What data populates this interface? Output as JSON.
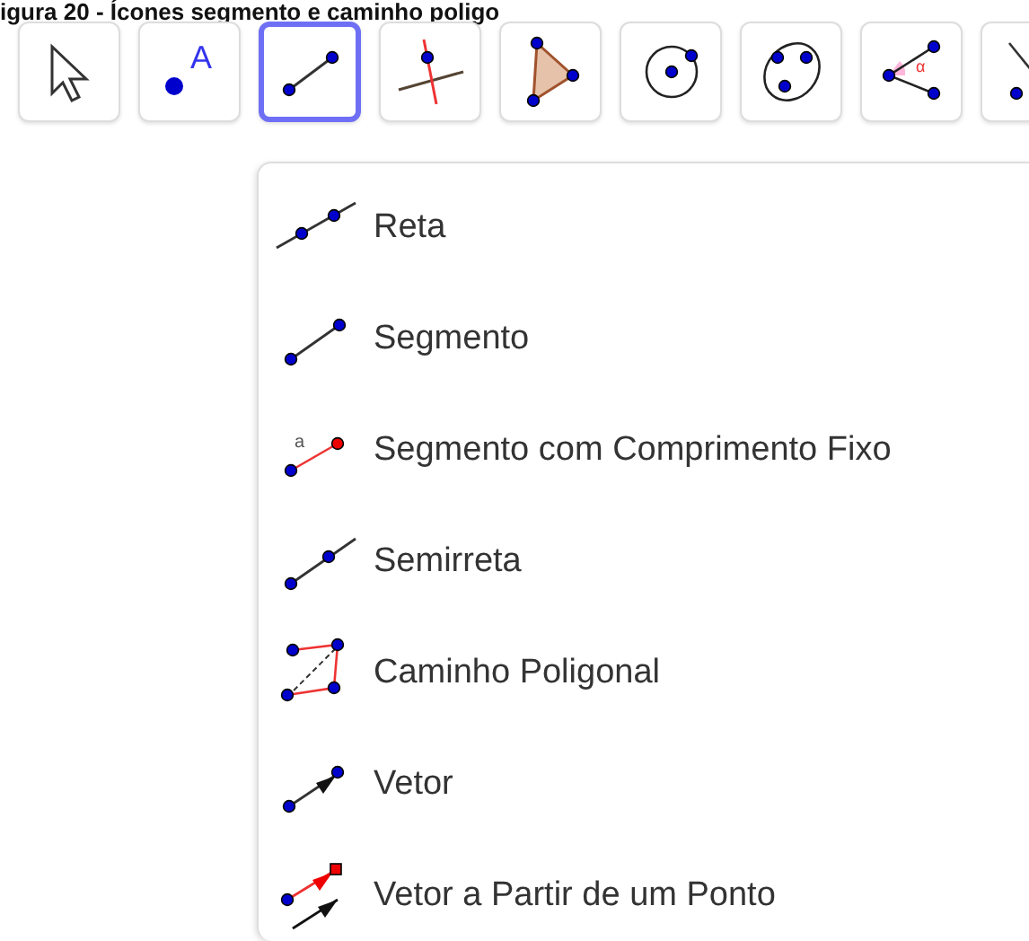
{
  "caption": "igura 20 - Ícones segmento e caminho poligo",
  "toolbar": {
    "tools": [
      {
        "kind": "move",
        "selected": false
      },
      {
        "kind": "point",
        "selected": false,
        "label": "A"
      },
      {
        "kind": "segment",
        "selected": true
      },
      {
        "kind": "perpendicular",
        "selected": false
      },
      {
        "kind": "polygon",
        "selected": false
      },
      {
        "kind": "circle",
        "selected": false
      },
      {
        "kind": "conic",
        "selected": false
      },
      {
        "kind": "angle",
        "selected": false,
        "label": "α"
      },
      {
        "kind": "slope",
        "selected": false
      }
    ]
  },
  "menu": {
    "items": [
      {
        "kind": "line",
        "label": "Reta"
      },
      {
        "kind": "segment",
        "label": "Segmento"
      },
      {
        "kind": "fixed",
        "label": "Segmento com Comprimento Fixo",
        "icon_label": "a"
      },
      {
        "kind": "ray",
        "label": "Semirreta"
      },
      {
        "kind": "polyline",
        "label": "Caminho Poligonal"
      },
      {
        "kind": "vector",
        "label": "Vetor"
      },
      {
        "kind": "vectorfrom",
        "label": "Vetor a Partir de um Ponto"
      }
    ]
  }
}
